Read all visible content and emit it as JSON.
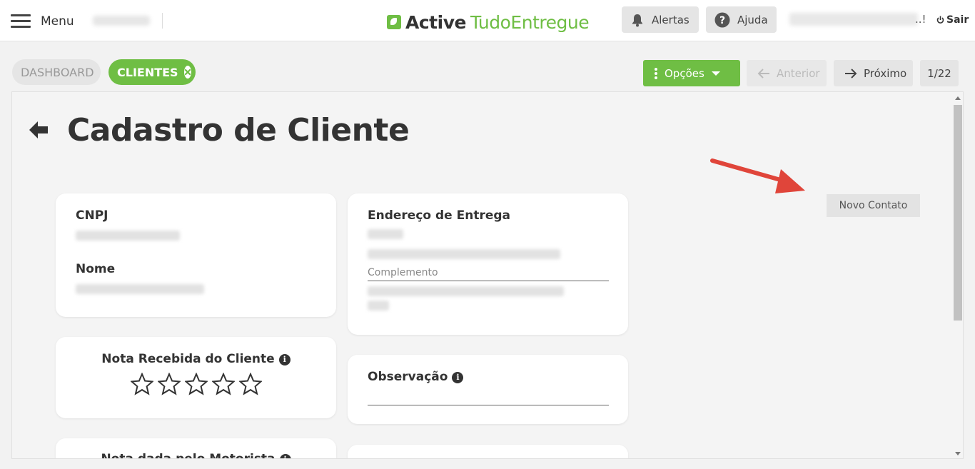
{
  "header": {
    "menu_label": "Menu",
    "brand_bold": "Active",
    "brand_rest": "TudoEntregue",
    "alertas_label": "Alertas",
    "ajuda_label": "Ajuda",
    "user_suffix": "..!",
    "sair_label": "Sair"
  },
  "breadcrumb": {
    "dashboard_label": "DASHBOARD",
    "clientes_label": "CLIENTES"
  },
  "navigation": {
    "opcoes_label": "Opções",
    "anterior_label": "Anterior",
    "proximo_label": "Próximo",
    "pager": "1/22"
  },
  "page": {
    "title": "Cadastro de Cliente",
    "novo_contato_label": "Novo Contato"
  },
  "cards": {
    "cnpj_label": "CNPJ",
    "nome_label": "Nome",
    "endereco_label": "Endereço de Entrega",
    "complemento_label": "Complemento",
    "nota_label": "Nota Recebida do Cliente",
    "observacao_label": "Observação",
    "nota_motorista_label": "Nota dada pelo Motorista",
    "rating": {
      "value": 0,
      "max": 5
    }
  },
  "colors": {
    "brand_green": "#6fbe44",
    "annotation_red": "#e0453a"
  },
  "icons": [
    "hamburger-icon",
    "bell-icon",
    "help-icon",
    "power-icon",
    "close-icon",
    "dots-icon",
    "caret-down-icon",
    "arrow-left-icon",
    "arrow-right-icon",
    "back-arrow-icon",
    "info-icon",
    "star-icon"
  ]
}
